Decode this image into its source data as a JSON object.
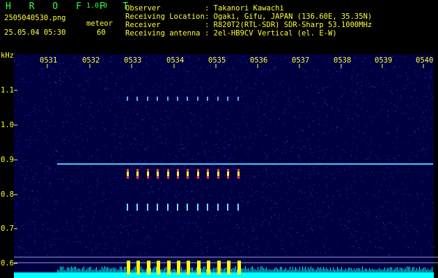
{
  "header": {
    "app_title": "H R O F F T",
    "version": "1.0.0",
    "filename": "2505040530.png",
    "datetime": "25.05.04 05:30",
    "mode_label": "meteor",
    "mode_value": "60"
  },
  "info": [
    {
      "label": "Observer",
      "value": ": Takanori Kawachi"
    },
    {
      "label": "Receiving Location",
      "value": ": Ogaki, Gifu, JAPAN (136.60E, 35.35N)"
    },
    {
      "label": "Receiver",
      "value": ": R820T2(RTL-SDR) SDR-Sharp 53.1000MHz"
    },
    {
      "label": "Receiving antenna",
      "value": ": 2el-HB9CV Vertical (el. E-W)"
    }
  ],
  "spectrogram": {
    "y_unit": "kHz",
    "time_ticks": [
      "0531",
      "0532",
      "0533",
      "0534",
      "0535",
      "0536",
      "0537",
      "0538",
      "0539",
      "0540"
    ],
    "freq_ticks": [
      "1.1",
      "1.0",
      "0.9",
      "0.8",
      "0.7",
      "0.6"
    ],
    "colors": {
      "background": "#000040",
      "noise": "#1a2acc",
      "carrier": "#4fc6ff",
      "yellow": "#ffff00",
      "cyan": "#00ffff"
    }
  }
}
